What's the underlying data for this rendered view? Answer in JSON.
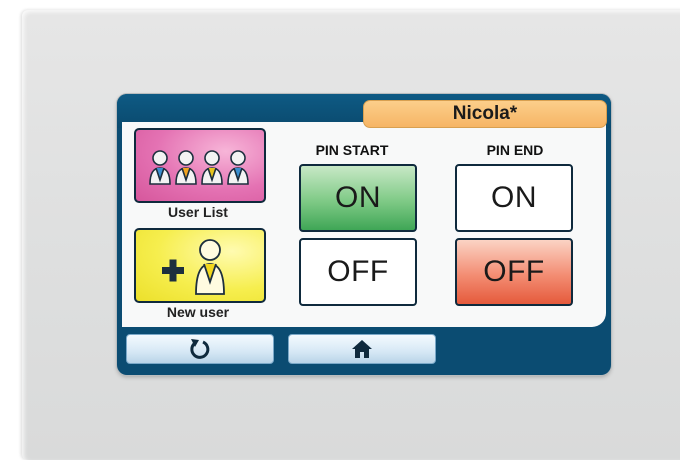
{
  "header": {
    "user_name": "Nicola*"
  },
  "tiles": {
    "user_list_label": "User List",
    "new_user_label": "New user"
  },
  "pin_start": {
    "title": "PIN START",
    "on_label": "ON",
    "off_label": "OFF",
    "state": "ON"
  },
  "pin_end": {
    "title": "PIN END",
    "on_label": "ON",
    "off_label": "OFF",
    "state": "OFF"
  },
  "nav": {
    "back_icon": "refresh-back-icon",
    "home_icon": "home-icon"
  },
  "colors": {
    "screen_frame": "#0b4c72",
    "user_label_bg": "#f6b565",
    "user_list_tile": "#e472b3",
    "new_user_tile": "#f6ee4e",
    "on_active": "#3fa656",
    "off_active": "#e55a3c"
  }
}
